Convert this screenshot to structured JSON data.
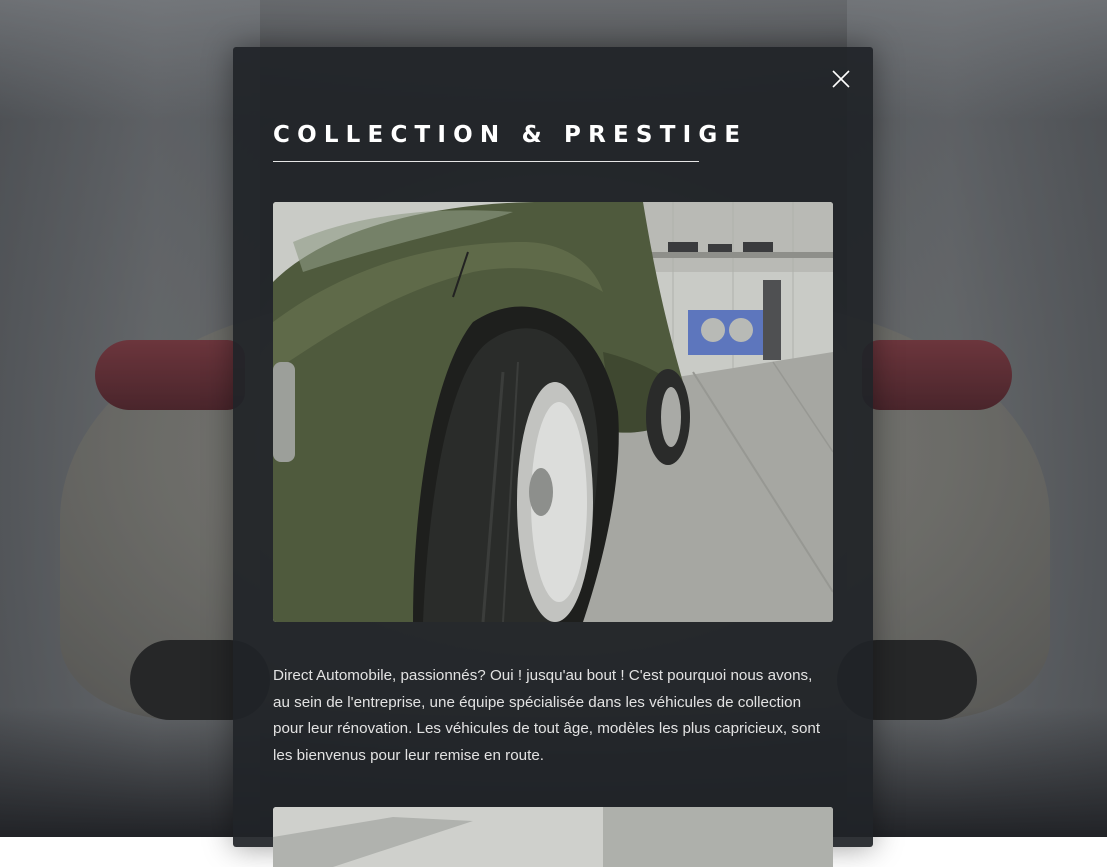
{
  "modal": {
    "title": "COLLECTION & PRESTIGE",
    "close_icon": "close-icon",
    "description": "Direct Automobile, passionnés? Oui ! jusqu'au bout ! C'est pourquoi nous avons, au sein de l'entreprise, une équipe spécialisée dans les véhicules de collection pour leur rénovation. Les véhicules de tout âge, modèles les plus capricieux, sont les bienvenus pour leur remise en route."
  },
  "colors": {
    "modal_background": "#202328",
    "title_text": "#ffffff",
    "body_text": "#e2e2e2"
  }
}
